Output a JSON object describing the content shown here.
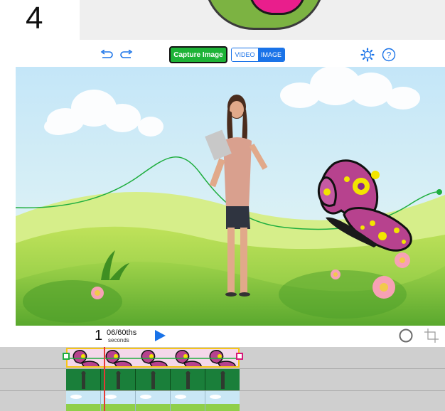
{
  "step": {
    "number": "4"
  },
  "toolbar": {
    "undo_icon": "undo-icon",
    "redo_icon": "redo-icon",
    "capture_label": "Capture Image",
    "mode_video_label": "VIDEO",
    "mode_image_label": "IMAGE",
    "settings_icon": "gear-icon",
    "help_icon": "help-icon",
    "help_glyph": "?"
  },
  "playback": {
    "time_whole": "1",
    "time_fraction": "06/60ths",
    "time_unit": "seconds",
    "play_icon": "play-icon",
    "record_icon": "circle-icon",
    "crop_icon": "crop-icon"
  },
  "colors": {
    "accent_blue": "#1a73e8",
    "capture_green": "#1db337",
    "playhead_red": "#e53935",
    "selection_yellow": "#f5c518"
  }
}
